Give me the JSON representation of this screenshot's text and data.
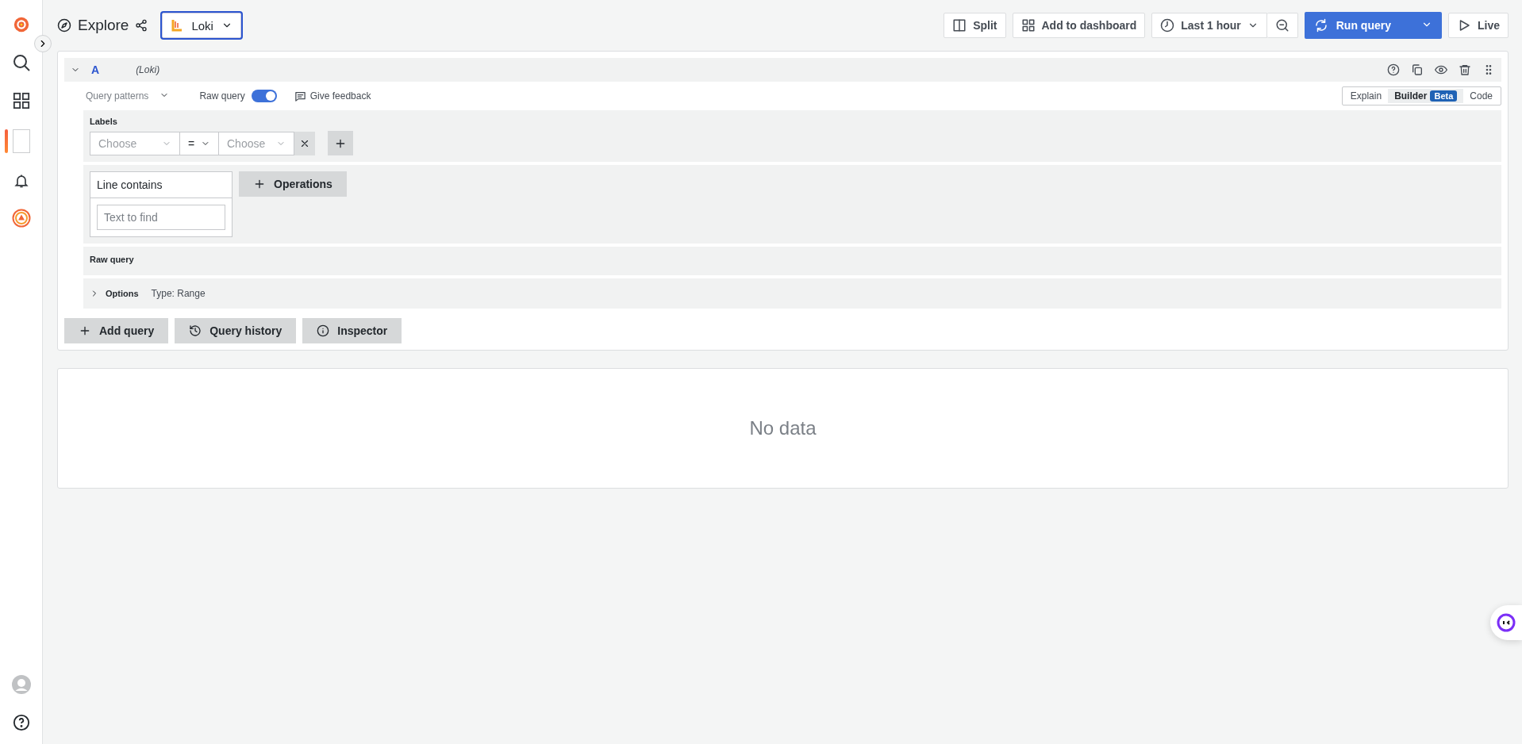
{
  "sidebar": {
    "items": [
      {
        "selected": false
      },
      {
        "selected": false
      },
      {
        "selected": false
      },
      {
        "selected": true
      },
      {
        "selected": false
      },
      {
        "selected": false
      }
    ]
  },
  "header": {
    "title": "Explore",
    "datasource": "Loki",
    "split": "Split",
    "add_to_dashboard": "Add to dashboard",
    "time_range": "Last 1 hour",
    "run_query": "Run query",
    "live": "Live"
  },
  "query": {
    "letter": "A",
    "datasource": "(Loki)",
    "query_patterns": "Query patterns",
    "raw_query": {
      "label": "Raw query",
      "on": true
    },
    "feedback": "Give feedback",
    "modes": [
      {
        "label": "Explain",
        "selected": false
      },
      {
        "label": "Builder",
        "badge": "Beta",
        "selected": true
      },
      {
        "label": "Code",
        "selected": false
      }
    ],
    "labels": {
      "title": "Labels",
      "label_placeholder": "Choose",
      "operator": "=",
      "value_placeholder": "Choose"
    },
    "operation": {
      "title": "Line contains",
      "placeholder": "Text to find",
      "add_button": "Operations"
    },
    "raw_query_title": "Raw query",
    "options": {
      "title": "Options",
      "expanded": false,
      "summary": "Type: Range"
    }
  },
  "actions": [
    "Add query",
    "Query history",
    "Inspector"
  ],
  "result": {
    "message": "No data"
  }
}
